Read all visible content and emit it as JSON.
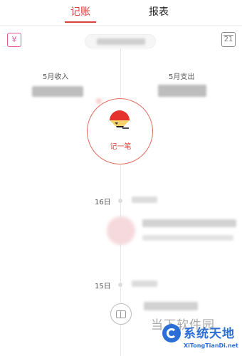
{
  "tabs": {
    "record": "记账",
    "report": "报表"
  },
  "header": {
    "wallet_icon": "yen-wallet-icon",
    "wallet_glyph": "¥",
    "calendar_icon": "calendar-icon",
    "calendar_day": "21"
  },
  "summary": {
    "income_label": "5月收入",
    "expense_label": "5月支出"
  },
  "record_button": {
    "label": "记一笔",
    "icon": "record-brand-icon"
  },
  "timeline": {
    "days": [
      {
        "label": "16日"
      },
      {
        "label": "15日"
      }
    ]
  },
  "bottom": {
    "book_icon": "book-icon"
  },
  "watermark": {
    "text": "当下软件园",
    "title": "系统天地",
    "url": "XiTongTianDi.net"
  },
  "colors": {
    "accent": "#d8433c",
    "wallet_pink": "#e05a9f",
    "watermark_blue": "#2b6fd6"
  }
}
